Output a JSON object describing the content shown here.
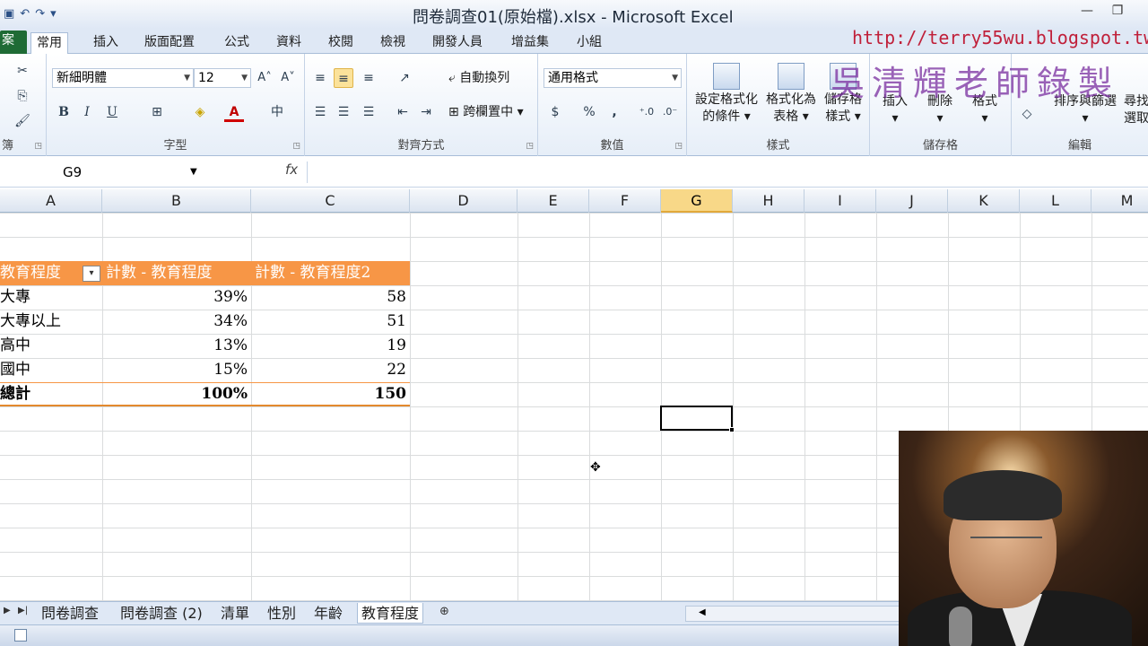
{
  "window": {
    "title": "問卷調查01(原始檔).xlsx - Microsoft Excel",
    "minimize_glyph": "—",
    "restore_glyph": "❐"
  },
  "qat": {
    "save": "▣",
    "undo": "↶",
    "redo": "↷",
    "customize": "▾"
  },
  "ribbon_tabs": [
    {
      "label": "案"
    },
    {
      "label": "常用"
    },
    {
      "label": "插入"
    },
    {
      "label": "版面配置"
    },
    {
      "label": "公式"
    },
    {
      "label": "資料"
    },
    {
      "label": "校閱"
    },
    {
      "label": "檢視"
    },
    {
      "label": "開發人員"
    },
    {
      "label": "增益集"
    },
    {
      "label": "小組"
    }
  ],
  "watermarks": {
    "url": "http://terry55wu.blogspot.tw",
    "teacher": "吳清輝老師錄製"
  },
  "clipboard": {
    "label": "簿",
    "cut": "✂",
    "copy": "⎘",
    "paint": "🖌"
  },
  "font": {
    "label": "字型",
    "font_name": "新細明體",
    "font_size": "12",
    "grow": "A˄",
    "shrink": "A˅",
    "bold": "B",
    "italic": "I",
    "underline": "U",
    "border": "⊞",
    "fill": "◈",
    "font_color": "A",
    "phonetic": "中"
  },
  "alignment": {
    "label": "對齊方式",
    "wrap_text": "自動換列",
    "merge_center": "跨欄置中"
  },
  "number": {
    "label": "數值",
    "format": "通用格式",
    "currency": "$",
    "percent": "%",
    "comma": ","
  },
  "styles": {
    "label": "樣式",
    "conditional_1": "設定格式化",
    "conditional_2": "的條件",
    "table_1": "格式化為",
    "table_2": "表格",
    "cell_styles_1": "儲存格",
    "cell_styles_2": "樣式"
  },
  "cells_group": {
    "label": "儲存格",
    "insert": "插入",
    "delete": "刪除",
    "format": "格式"
  },
  "editing": {
    "label": "編輯",
    "sort_filter": "排序與篩選",
    "find_1": "尋找",
    "find_2": "選取"
  },
  "formula_bar": {
    "name_box": "G9",
    "fx": "fx",
    "formula": ""
  },
  "columns": [
    "A",
    "B",
    "C",
    "D",
    "E",
    "F",
    "G",
    "H",
    "I",
    "J",
    "K",
    "L",
    "M"
  ],
  "selected_column": "G",
  "pivot": {
    "headers": [
      "教育程度",
      "計數 - 教育程度",
      "計數 - 教育程度2"
    ],
    "filter_glyph": "▾",
    "rows": [
      {
        "label": "大專",
        "pct": "39%",
        "count": "58"
      },
      {
        "label": "大專以上",
        "pct": "34%",
        "count": "51"
      },
      {
        "label": "高中",
        "pct": "13%",
        "count": "19"
      },
      {
        "label": "國中",
        "pct": "15%",
        "count": "22"
      }
    ],
    "total": {
      "label": "總計",
      "pct": "100%",
      "count": "150"
    }
  },
  "sheet_tabs": [
    {
      "label": "問卷調查"
    },
    {
      "label": "問卷調查 (2)"
    },
    {
      "label": "清單"
    },
    {
      "label": "性別"
    },
    {
      "label": "年齡"
    },
    {
      "label": "教育程度"
    }
  ],
  "active_sheet": "教育程度",
  "cursor_glyph": "✥"
}
